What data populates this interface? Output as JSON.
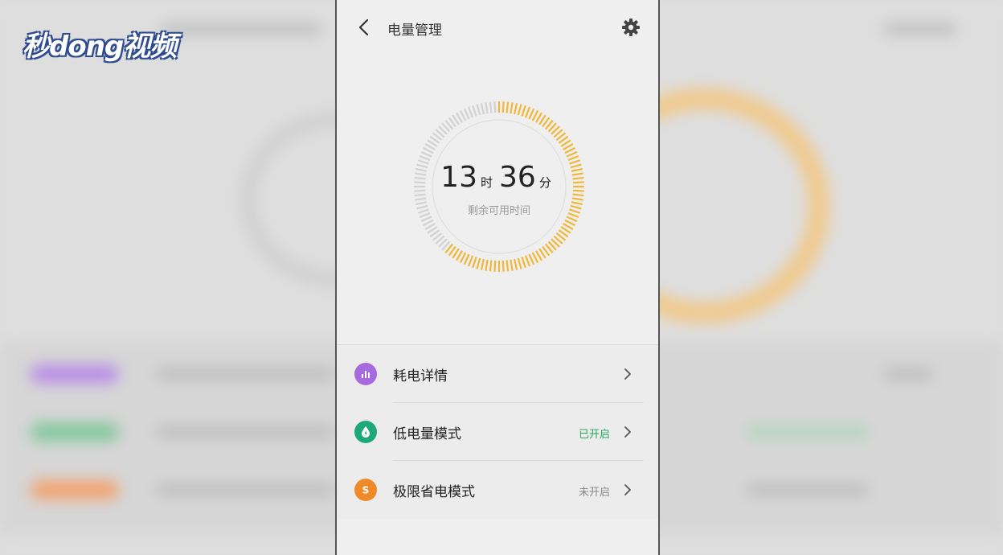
{
  "watermark": {
    "text": "秒dong视频"
  },
  "header": {
    "title": "电量管理",
    "back_icon": "chevron-left-icon",
    "settings_icon": "gear-icon"
  },
  "battery": {
    "hours": "13",
    "hours_unit": "时",
    "minutes": "36",
    "minutes_unit": "分",
    "label": "剩余可用时间",
    "remaining_fraction": 0.62,
    "ring_color": "#f0b73a",
    "track_color": "#d2d2d2"
  },
  "menu": {
    "items": [
      {
        "label": "耗电详情",
        "status": "",
        "icon": "bar-chart-icon",
        "icon_color": "#a56bde"
      },
      {
        "label": "低电量模式",
        "status": "已开启",
        "icon": "drop-icon",
        "icon_color": "#1ea87a",
        "status_color": "#2aa45f"
      },
      {
        "label": "极限省电模式",
        "status": "未开启",
        "icon": "s-letter-icon",
        "icon_color": "#f08a28",
        "status_color": "#888888"
      }
    ]
  }
}
